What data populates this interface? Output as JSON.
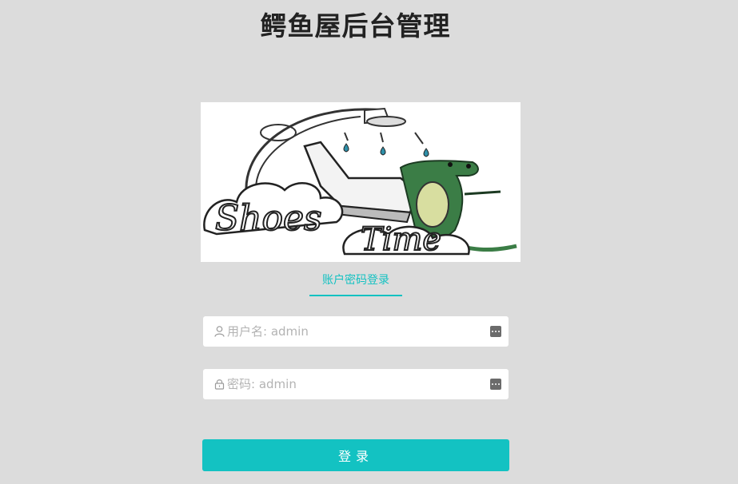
{
  "page": {
    "title": "鳄鱼屋后台管理"
  },
  "logo": {
    "text": "ShoesTime"
  },
  "tabs": [
    {
      "label": "账户密码登录",
      "active": true
    }
  ],
  "form": {
    "username": {
      "placeholder": "用户名: admin",
      "value": "",
      "icon": "user-icon",
      "suffix_icon": "password-manager-icon"
    },
    "password": {
      "placeholder": "密码: admin",
      "value": "",
      "icon": "lock-icon",
      "suffix_icon": "password-manager-icon"
    },
    "submit_label": "登录"
  },
  "colors": {
    "accent": "#13c2c2",
    "background": "#dcdcdc",
    "title": "#222222"
  }
}
